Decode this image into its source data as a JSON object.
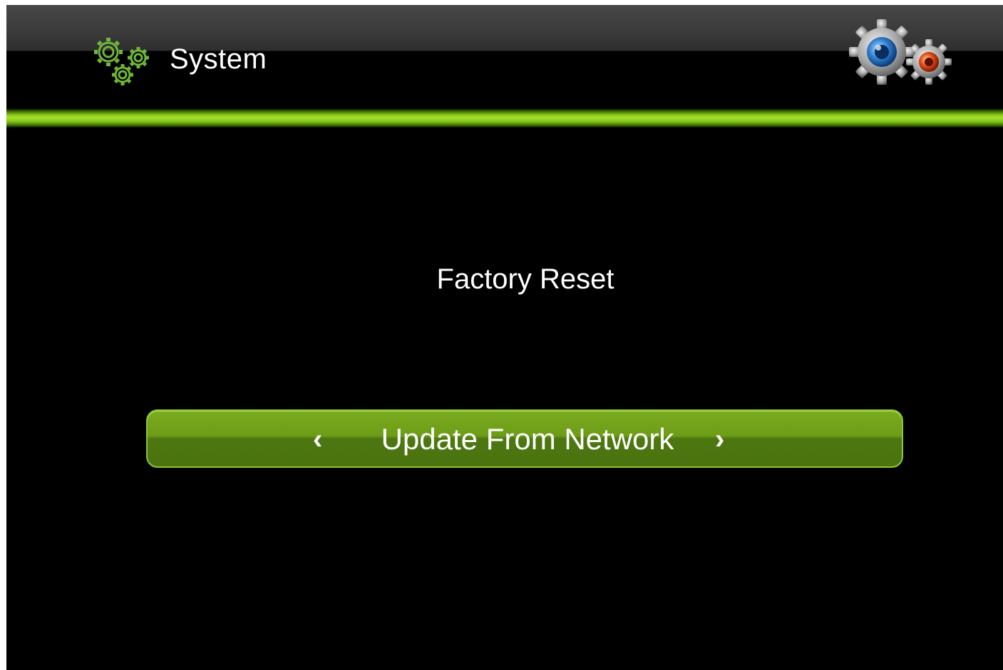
{
  "header": {
    "title": "System",
    "section_icon": "gears-outline-icon",
    "decor_icon": "settings-gears-icon"
  },
  "main": {
    "option_label": "Factory Reset",
    "selector": {
      "value": "Update From Network",
      "prev_icon": "chevron-left-icon",
      "next_icon": "chevron-right-icon",
      "prev_glyph": "‹",
      "next_glyph": "›"
    }
  },
  "colors": {
    "accent_green": "#8fd11f",
    "selector_green": "#6d9c17",
    "background": "#000000",
    "text": "#ffffff"
  }
}
